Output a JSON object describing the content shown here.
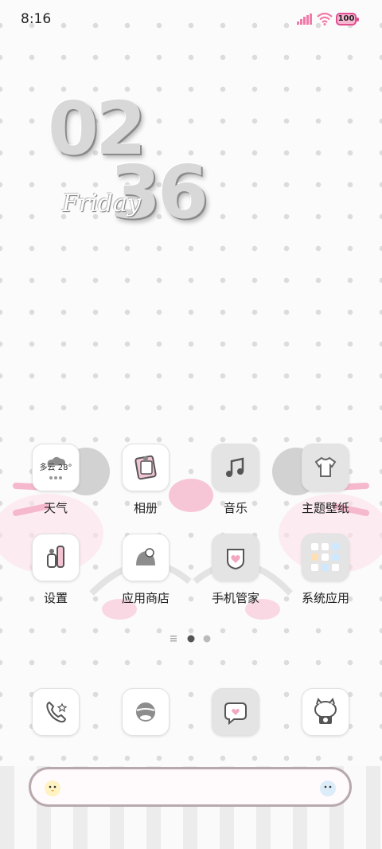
{
  "status_bar": {
    "time": "8:16",
    "battery": "100"
  },
  "clock": {
    "hours": "02",
    "minutes": "36",
    "day": "Friday"
  },
  "apps_row1": [
    {
      "label": "天气",
      "icon": "weather-icon",
      "widget_text": "多云 28°"
    },
    {
      "label": "相册",
      "icon": "photo-album-icon"
    },
    {
      "label": "音乐",
      "icon": "music-icon"
    },
    {
      "label": "主题壁纸",
      "icon": "theme-shirt-icon"
    }
  ],
  "apps_row2": [
    {
      "label": "设置",
      "icon": "settings-icon"
    },
    {
      "label": "应用商店",
      "icon": "app-store-icon"
    },
    {
      "label": "手机管家",
      "icon": "phone-manager-icon"
    },
    {
      "label": "系统应用",
      "icon": "system-apps-folder-icon"
    }
  ],
  "page_indicator": {
    "pages": 2,
    "current": 1
  },
  "dock": [
    {
      "icon": "phone-icon"
    },
    {
      "icon": "browser-icon"
    },
    {
      "icon": "messages-icon"
    },
    {
      "icon": "camera-icon"
    }
  ],
  "colors": {
    "accent": "#f4b8cf",
    "battery": "#e0508e",
    "grey": "#d0d0d0"
  }
}
